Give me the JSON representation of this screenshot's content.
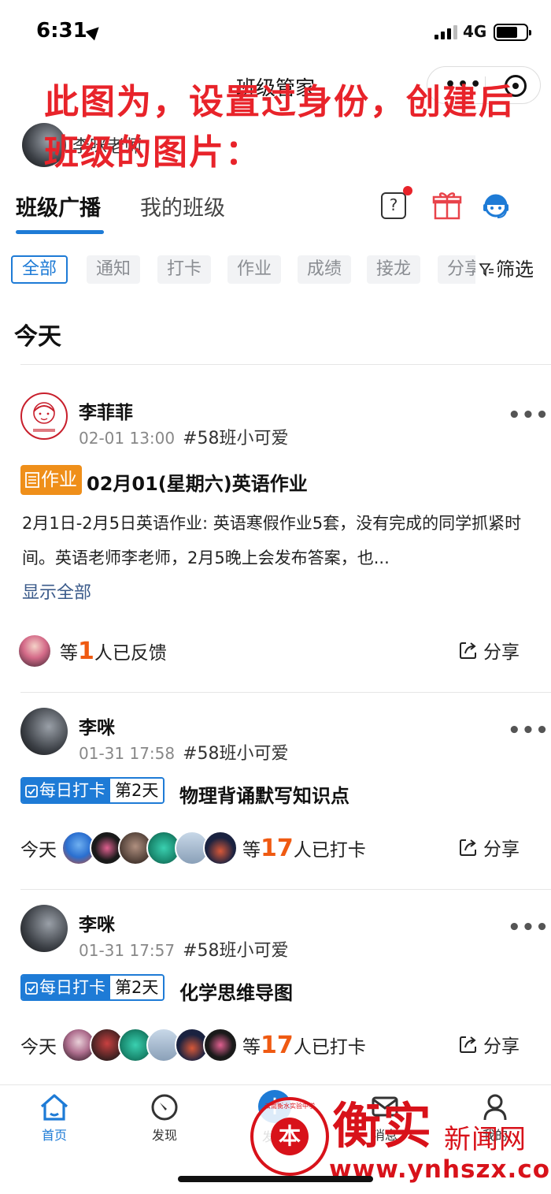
{
  "status_bar": {
    "time": "6:31",
    "network": "4G"
  },
  "nav": {
    "title": "班级管家"
  },
  "overlay_note": "此图为，设置过身份，创建后班级的图片：",
  "current_user": {
    "name": "李咪老师"
  },
  "tabs": [
    {
      "label": "班级广播",
      "active": true
    },
    {
      "label": "我的班级",
      "active": false
    }
  ],
  "filters": {
    "chips": [
      "全部",
      "通知",
      "打卡",
      "作业",
      "成绩",
      "接龙",
      "分享"
    ],
    "active": "全部",
    "filter_label": "筛选"
  },
  "section_title": "今天",
  "posts": [
    {
      "author": "李菲菲",
      "time": "02-01 13:00",
      "class": "#58班小可爱",
      "tag": "作业",
      "title": "02月01(星期六)英语作业",
      "body": "2月1日-2月5日英语作业: 英语寒假作业5套，没有完成的同学抓紧时间。英语老师李老师，2月5晚上会发布答案，也...",
      "show_all": "显示全部",
      "feedback_prefix": "等",
      "feedback_count": "1",
      "feedback_suffix": "人已反馈",
      "share": "分享"
    },
    {
      "author": "李咪",
      "time": "01-31 17:58",
      "class": "#58班小可爱",
      "tag": "每日打卡",
      "day": "第2天",
      "title": "物理背诵默写知识点",
      "today": "今天",
      "checkin_prefix": "等",
      "checkin_count": "17",
      "checkin_suffix": "人已打卡",
      "share": "分享"
    },
    {
      "author": "李咪",
      "time": "01-31 17:57",
      "class": "#58班小可爱",
      "tag": "每日打卡",
      "day": "第2天",
      "title": "化学思维导图",
      "today": "今天",
      "checkin_prefix": "等",
      "checkin_count": "17",
      "checkin_suffix": "人已打卡",
      "share": "分享"
    }
  ],
  "tabbar": [
    {
      "label": "首页",
      "icon": "home-icon",
      "active": true
    },
    {
      "label": "发现",
      "icon": "compass-icon",
      "active": false
    },
    {
      "label": "发布",
      "icon": "plus-icon",
      "active": false
    },
    {
      "label": "消息",
      "icon": "message-icon",
      "active": false
    },
    {
      "label": "我的",
      "icon": "person-icon",
      "active": false
    }
  ],
  "watermark": {
    "brand": "衡实",
    "subtitle": "新闻网",
    "url": "www.ynhszx.com",
    "seal_text": "云南衡水实验中学"
  },
  "colors": {
    "accent": "#1e7bd6",
    "homework": "#ef8f1a",
    "count": "#ef5a12",
    "note": "#e8232a"
  }
}
